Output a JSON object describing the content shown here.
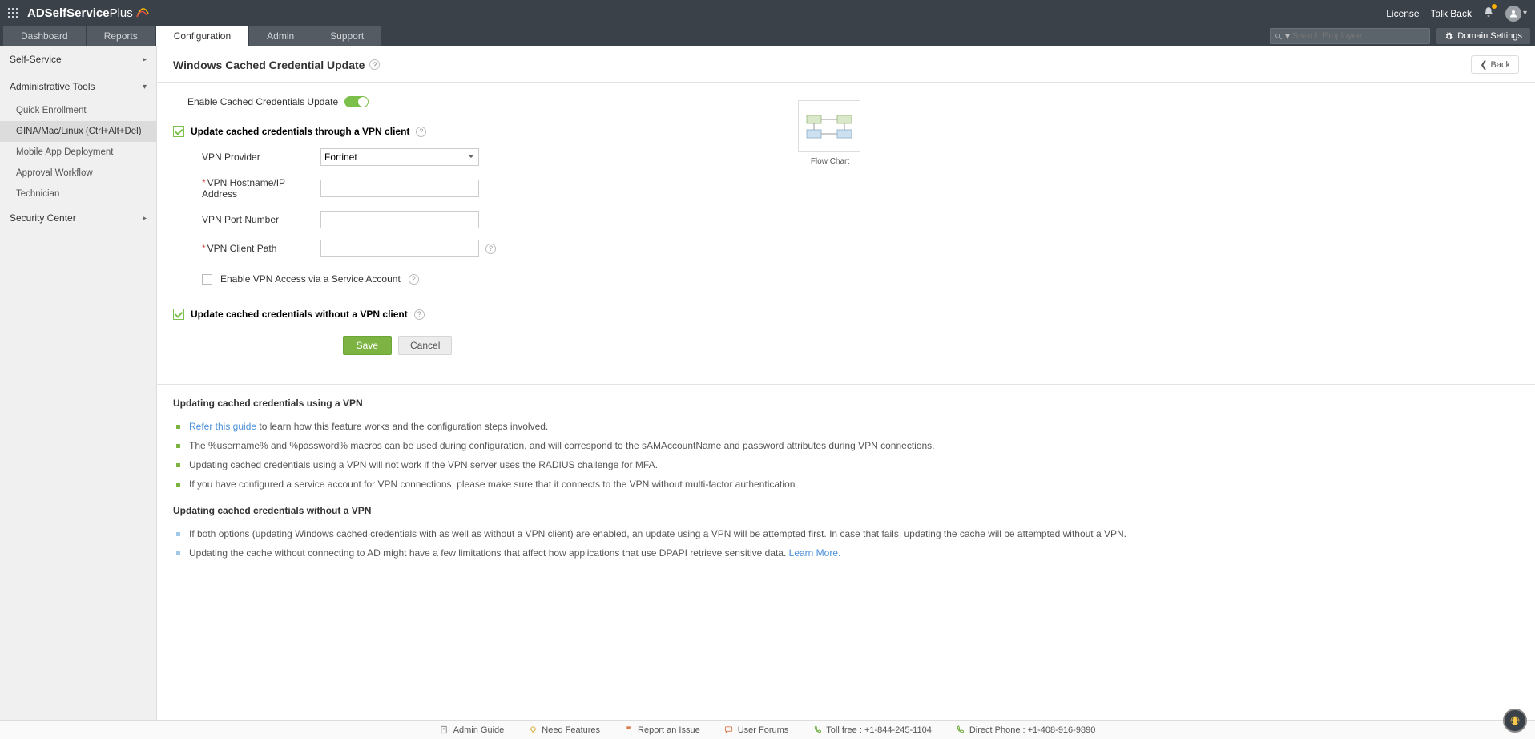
{
  "header": {
    "product_bold": "ADSelfService",
    "product_light": " Plus",
    "license": "License",
    "talkback": "Talk Back"
  },
  "tabs": [
    "Dashboard",
    "Reports",
    "Configuration",
    "Admin",
    "Support"
  ],
  "active_tab": "Configuration",
  "search_placeholder": "Search Employee",
  "domain_settings": "Domain Settings",
  "sidebar": {
    "groups": [
      {
        "label": "Self-Service",
        "expanded": false
      },
      {
        "label": "Administrative Tools",
        "expanded": true,
        "items": [
          "Quick Enrollment",
          "GINA/Mac/Linux (Ctrl+Alt+Del)",
          "Mobile App Deployment",
          "Approval Workflow",
          "Technician"
        ],
        "active_item": "GINA/Mac/Linux (Ctrl+Alt+Del)"
      },
      {
        "label": "Security Center",
        "expanded": false
      }
    ]
  },
  "page": {
    "title": "Windows Cached Credential Update",
    "back": "Back",
    "enable_label": "Enable Cached Credentials Update",
    "enable_on": true,
    "section_vpn_title": "Update cached credentials through a VPN client",
    "section_vpn_checked": true,
    "fields": {
      "vpn_provider_label": "VPN Provider",
      "vpn_provider_value": "Fortinet",
      "vpn_host_label": "VPN Hostname/IP Address",
      "vpn_host_value": "",
      "vpn_port_label": "VPN Port Number",
      "vpn_port_value": "",
      "vpn_client_label": "VPN Client Path",
      "vpn_client_value": ""
    },
    "svc_account_label": "Enable VPN Access via a Service Account",
    "section_novpn_title": "Update cached credentials without a VPN client",
    "section_novpn_checked": true,
    "flowchart_caption": "Flow Chart",
    "save": "Save",
    "cancel": "Cancel"
  },
  "info": {
    "t1": "Updating cached credentials using a VPN",
    "i1_link": "Refer this guide",
    "i1_rest": " to learn how this feature works and the configuration steps involved.",
    "i2": "The %username% and %password% macros can be used during configuration, and will correspond to the sAMAccountName and password attributes during VPN connections.",
    "i3": "Updating cached credentials using a VPN will not work if the VPN server uses the RADIUS challenge for MFA.",
    "i4": "If you have configured a service account for VPN connections, please make sure that it connects to the VPN without multi-factor authentication.",
    "t2": "Updating cached credentials without a VPN",
    "i5": "If both options (updating Windows cached credentials with as well as without a VPN client) are enabled, an update using a VPN will be attempted first. In case that fails, updating the cache will be attempted without a VPN.",
    "i6_text": "Updating the cache without connecting to AD might have a few limitations that affect how applications that use DPAPI retrieve sensitive data. ",
    "i6_link": "Learn More."
  },
  "footer": {
    "admin_guide": "Admin Guide",
    "need_features": "Need Features",
    "report_issue": "Report an Issue",
    "user_forums": "User Forums",
    "toll_free": "Toll free : +1-844-245-1104",
    "direct": "Direct Phone : +1-408-916-9890"
  }
}
